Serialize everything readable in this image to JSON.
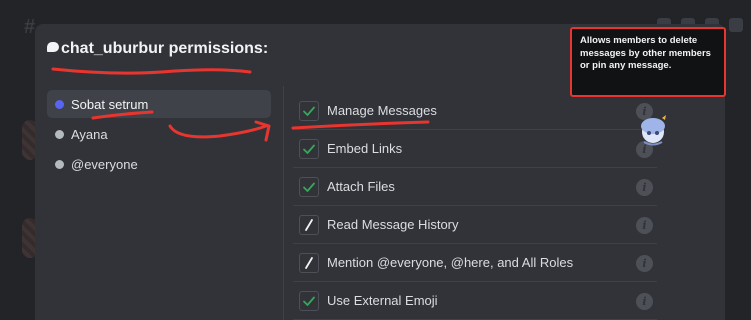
{
  "modal": {
    "title": "chat_uburbur permissions:"
  },
  "roles": [
    {
      "label": "Sobat setrum",
      "color": "#5865f2",
      "active": true
    },
    {
      "label": "Ayana",
      "color": "#b5bac1",
      "active": false
    },
    {
      "label": "@everyone",
      "color": "#b5bac1",
      "active": false
    }
  ],
  "permissions": [
    {
      "label": "Manage Messages",
      "state": "allow"
    },
    {
      "label": "Embed Links",
      "state": "allow"
    },
    {
      "label": "Attach Files",
      "state": "allow"
    },
    {
      "label": "Read Message History",
      "state": "neutral"
    },
    {
      "label": "Mention @everyone, @here, and All Roles",
      "state": "neutral"
    },
    {
      "label": "Use External Emoji",
      "state": "allow"
    }
  ],
  "tooltip": {
    "text": "Allows members to delete messages by other members or pin any message."
  },
  "colors": {
    "annotation": "#e8352f",
    "check": "#3ba55c"
  }
}
